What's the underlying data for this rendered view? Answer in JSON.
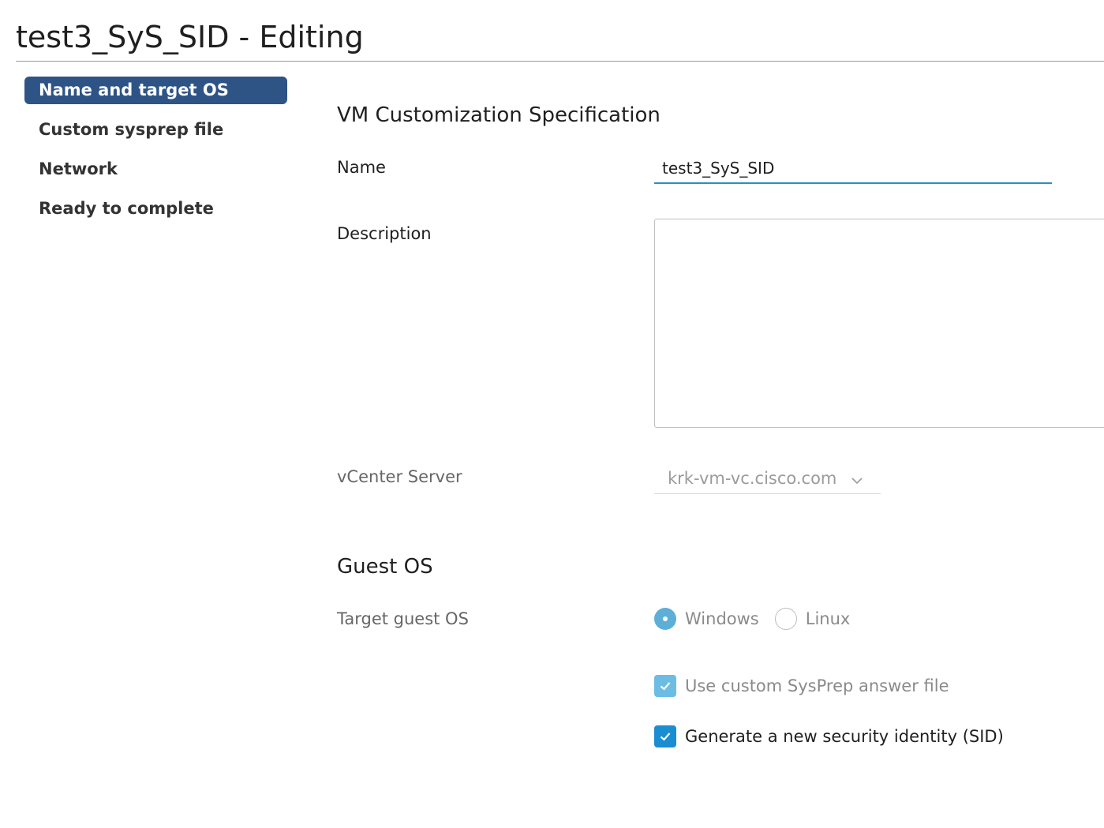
{
  "header": {
    "title": "test3_SyS_SID - Editing"
  },
  "steps": [
    {
      "label": "Name and target OS",
      "active": true
    },
    {
      "label": "Custom sysprep file",
      "active": false
    },
    {
      "label": "Network",
      "active": false
    },
    {
      "label": "Ready to complete",
      "active": false
    }
  ],
  "main": {
    "section_title": "VM Customization Specification",
    "name": {
      "label": "Name",
      "value": "test3_SyS_SID"
    },
    "description": {
      "label": "Description",
      "value": ""
    },
    "vcenter": {
      "label": "vCenter Server",
      "selected": "krk-vm-vc.cisco.com"
    },
    "guest_os": {
      "section_title": "Guest OS",
      "target_label": "Target guest OS",
      "options": [
        {
          "label": "Windows",
          "selected": true
        },
        {
          "label": "Linux",
          "selected": false
        }
      ],
      "use_custom_sysprep": {
        "label": "Use custom SysPrep answer file",
        "checked": true,
        "disabled": true
      },
      "generate_sid": {
        "label": "Generate a new security identity (SID)",
        "checked": true,
        "disabled": false
      }
    }
  },
  "colors": {
    "active_step_bg": "#2e5486",
    "input_underline": "#2a8ec6",
    "radio_selected": "#5dafd8",
    "checkbox_disabled": "#6cbde3",
    "checkbox_enabled": "#1a8ed0"
  },
  "icons": {
    "select_arrow": "chevron-down-icon",
    "checkmark": "checkmark-icon"
  }
}
